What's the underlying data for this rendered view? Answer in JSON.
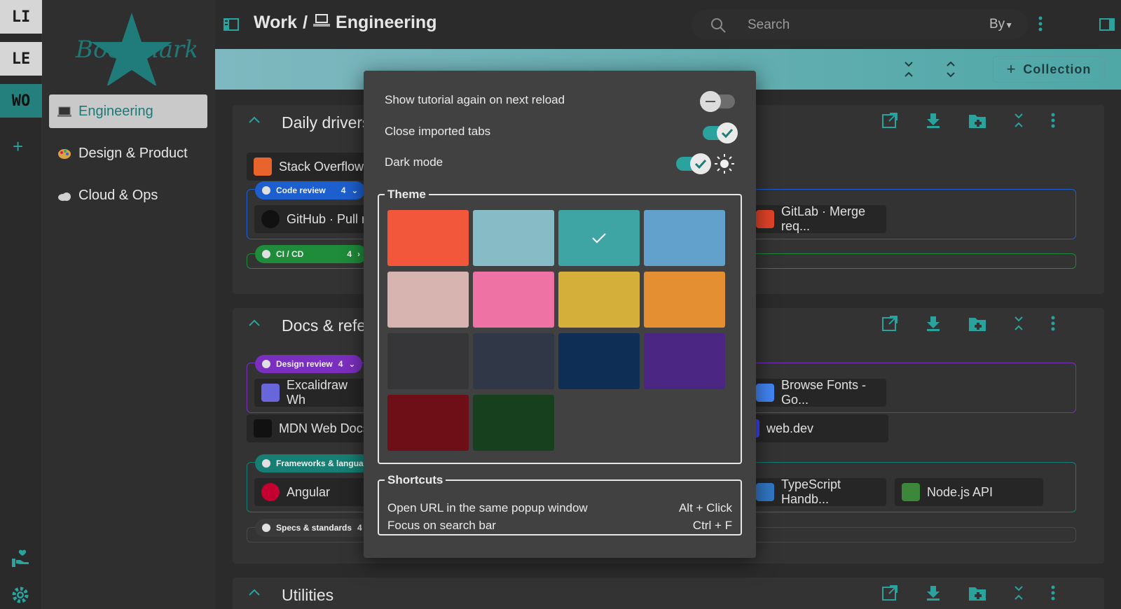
{
  "workspaces": [
    "LI",
    "LE",
    "WO"
  ],
  "app": {
    "logo_text": "Bookmarks"
  },
  "sidebar": {
    "items": [
      {
        "label": "Engineering",
        "emoji": "laptop"
      },
      {
        "label": "Design & Product",
        "emoji": "palette"
      },
      {
        "label": "Cloud & Ops",
        "emoji": "cloud"
      }
    ]
  },
  "header": {
    "crumb_parent": "Work",
    "crumb_sep": "/",
    "crumb_current": "Engineering"
  },
  "search": {
    "placeholder": "Search",
    "sort_label": "By"
  },
  "toolbar": {
    "add_collection_label": "Collection"
  },
  "collections": [
    {
      "title": "Daily drivers",
      "tabs": [
        {
          "title": "Stack Overflow"
        }
      ],
      "groups": [
        {
          "name": "Code review",
          "count": "4",
          "color": "#1e5fcf",
          "tabs": [
            "GitHub · Pull r",
            "GitLab · Merge req..."
          ]
        },
        {
          "name": "CI / CD",
          "count": "4",
          "color": "#1e8c3a"
        }
      ]
    },
    {
      "title": "Docs & refe",
      "groups": [
        {
          "name": "Design review",
          "count": "4",
          "color": "#7b2fbf",
          "tabs": [
            "Excalidraw Wh",
            "Browse Fonts - Go..."
          ]
        },
        {
          "name": "Frameworks & langua",
          "color": "#167e72",
          "tabs": [
            "Angular",
            "TypeScript Handb...",
            "Node.js API"
          ]
        },
        {
          "name": "Specs & standards",
          "count": "4",
          "color": "#3a3a3a"
        }
      ],
      "tabs": [
        {
          "title": "MDN Web Docs"
        },
        {
          "title": "web.dev"
        }
      ]
    },
    {
      "title": "Utilities"
    }
  ],
  "settings": {
    "show_tutorial": {
      "label": "Show tutorial again on next reload",
      "on": false
    },
    "close_imported_tabs": {
      "label": "Close imported tabs",
      "on": true
    },
    "dark_mode": {
      "label": "Dark mode",
      "on": true
    },
    "theme": {
      "legend": "Theme",
      "selected_index": 2,
      "swatches": [
        "#f2573b",
        "#87bcc6",
        "#3fa5a4",
        "#62a1cb",
        "#d8b4b0",
        "#ee72a3",
        "#d4af3a",
        "#e48f32",
        "#363638",
        "#303848",
        "#0e2e56",
        "#4b2682",
        "#6e0f17",
        "#17401f"
      ]
    },
    "shortcuts": {
      "legend": "Shortcuts",
      "rows": [
        {
          "action": "Open URL in the same popup window",
          "keys": "Alt + Click"
        },
        {
          "action": "Focus on search bar",
          "keys": "Ctrl + F"
        }
      ]
    }
  }
}
